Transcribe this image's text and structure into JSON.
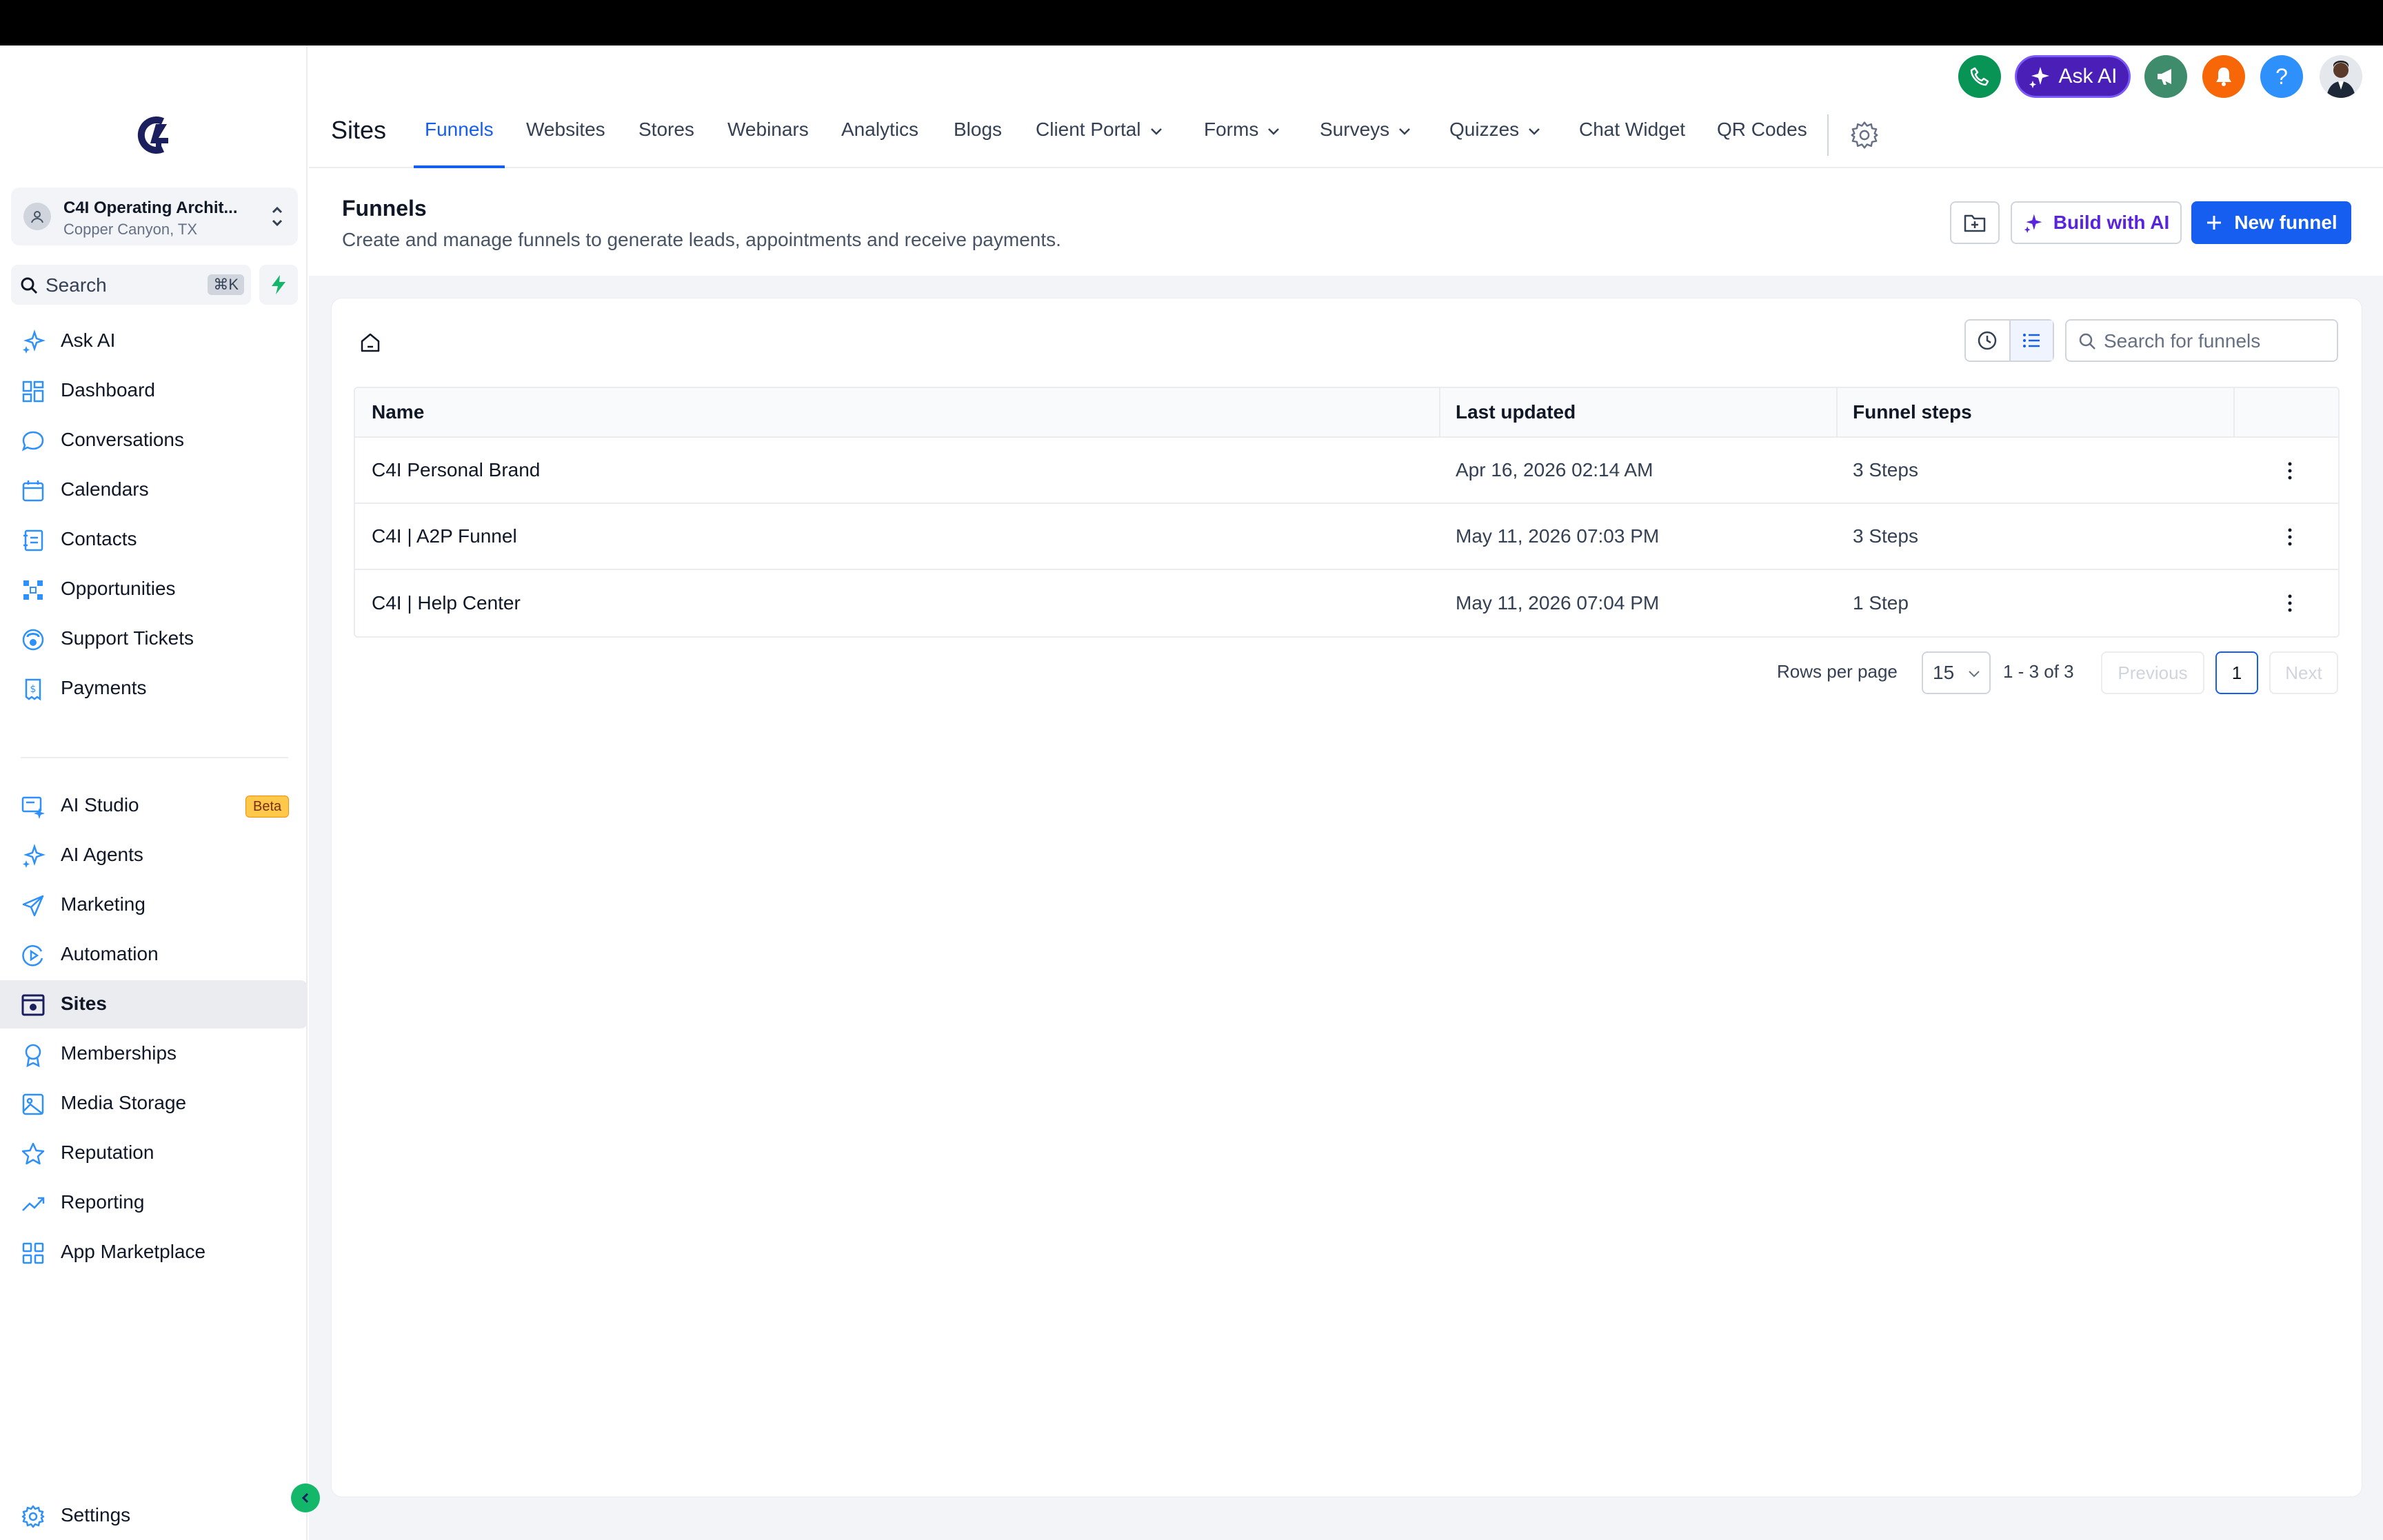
{
  "account": {
    "name": "C4I Operating Archit...",
    "location": "Copper Canyon, TX"
  },
  "sidebar": {
    "search_label": "Search",
    "search_shortcut": "⌘K",
    "items": [
      {
        "label": "Ask AI",
        "icon": "sparkle-icon"
      },
      {
        "label": "Dashboard",
        "icon": "grid-icon"
      },
      {
        "label": "Conversations",
        "icon": "chat-icon"
      },
      {
        "label": "Calendars",
        "icon": "calendar-icon"
      },
      {
        "label": "Contacts",
        "icon": "contacts-icon"
      },
      {
        "label": "Opportunities",
        "icon": "network-icon"
      },
      {
        "label": "Support Tickets",
        "icon": "support-icon"
      },
      {
        "label": "Payments",
        "icon": "receipt-icon"
      },
      {
        "label": "AI Studio",
        "icon": "ai-studio-icon",
        "badge": "Beta"
      },
      {
        "label": "AI Agents",
        "icon": "sparkle-icon"
      },
      {
        "label": "Marketing",
        "icon": "send-icon"
      },
      {
        "label": "Automation",
        "icon": "play-circle-icon"
      },
      {
        "label": "Sites",
        "icon": "browser-icon",
        "active": true
      },
      {
        "label": "Memberships",
        "icon": "award-icon"
      },
      {
        "label": "Media Storage",
        "icon": "image-icon"
      },
      {
        "label": "Reputation",
        "icon": "star-icon"
      },
      {
        "label": "Reporting",
        "icon": "trend-icon"
      },
      {
        "label": "App Marketplace",
        "icon": "apps-icon"
      }
    ],
    "settings_label": "Settings"
  },
  "header": {
    "title": "Sites",
    "ask_ai_label": "Ask AI",
    "help_label": "?",
    "tabs": [
      {
        "label": "Funnels",
        "active": true
      },
      {
        "label": "Websites"
      },
      {
        "label": "Stores"
      },
      {
        "label": "Webinars"
      },
      {
        "label": "Analytics"
      },
      {
        "label": "Blogs"
      },
      {
        "label": "Client Portal",
        "dropdown": true
      },
      {
        "label": "Forms",
        "dropdown": true
      },
      {
        "label": "Surveys",
        "dropdown": true
      },
      {
        "label": "Quizzes",
        "dropdown": true
      },
      {
        "label": "Chat Widget"
      },
      {
        "label": "QR Codes"
      }
    ]
  },
  "funnels": {
    "title": "Funnels",
    "subtitle": "Create and manage funnels to generate leads, appointments and receive payments.",
    "build_ai_label": "Build with AI",
    "new_funnel_label": "New funnel",
    "search_placeholder": "Search for funnels",
    "columns": [
      "Name",
      "Last updated",
      "Funnel steps"
    ],
    "rows": [
      {
        "name": "C4I Personal Brand",
        "updated": "Apr 16, 2026 02:14 AM",
        "steps": "3 Steps"
      },
      {
        "name": "C4I | A2P Funnel",
        "updated": "May 11, 2026 07:03 PM",
        "steps": "3 Steps"
      },
      {
        "name": "C4I | Help Center",
        "updated": "May 11, 2026 07:04 PM",
        "steps": "1 Step"
      }
    ],
    "pagination": {
      "rows_per_page_label": "Rows per page",
      "rows_per_page": "15",
      "range": "1 - 3 of 3",
      "previous": "Previous",
      "page": "1",
      "next": "Next"
    }
  },
  "colors": {
    "primary": "#155eef",
    "ask_ai": "#4a1fb8",
    "phone": "#079455",
    "announce": "#3f8c6d",
    "bell": "#f76707",
    "help": "#2e90fa"
  }
}
